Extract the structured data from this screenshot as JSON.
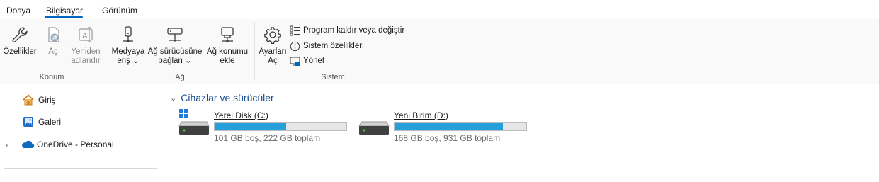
{
  "menu": {
    "tabs": [
      "Dosya",
      "Bilgisayar",
      "Görünüm"
    ],
    "active": "Bilgisayar"
  },
  "ribbon": {
    "konum": {
      "label": "Konum",
      "buttons": [
        {
          "label_1": "Özellikler",
          "label_2": "",
          "icon": "wrench-icon",
          "enabled": true
        },
        {
          "label_1": "Aç",
          "label_2": "",
          "icon": "open-icon",
          "enabled": false
        },
        {
          "label_1": "Yeniden",
          "label_2": "adlandır",
          "icon": "rename-icon",
          "enabled": false
        }
      ]
    },
    "ag": {
      "label": "Ağ",
      "buttons": [
        {
          "label_1": "Medyaya",
          "label_2": "eriş",
          "icon": "media-access-icon",
          "dropdown": true
        },
        {
          "label_1": "Ağ sürücüsüne",
          "label_2": "bağlan",
          "icon": "map-network-drive-icon",
          "dropdown": true
        },
        {
          "label_1": "Ağ konumu",
          "label_2": "ekle",
          "icon": "add-network-location-icon",
          "dropdown": false
        }
      ]
    },
    "sistem": {
      "label": "Sistem",
      "settings": {
        "label_1": "Ayarları",
        "label_2": "Aç",
        "icon": "gear-icon"
      },
      "items": [
        {
          "label": "Program kaldır veya değiştir",
          "icon": "program-list-icon"
        },
        {
          "label": "Sistem özellikleri",
          "icon": "info-icon"
        },
        {
          "label": "Yönet",
          "icon": "manage-icon"
        }
      ]
    }
  },
  "nav": {
    "items": [
      {
        "label": "Giriş",
        "icon": "home-icon"
      },
      {
        "label": "Galeri",
        "icon": "gallery-icon"
      },
      {
        "label": "OneDrive - Personal",
        "icon": "onedrive-cloud-icon",
        "expandable": true
      }
    ]
  },
  "content": {
    "section_title": "Cihazlar ve sürücüler",
    "drives": [
      {
        "name": "Yerel Disk (C:)",
        "info": "101 GB boş, 222 GB toplam",
        "used_fraction": 0.545,
        "windows_badge": true
      },
      {
        "name": "Yeni Birim (D:)",
        "info": "168 GB boş, 931 GB toplam",
        "used_fraction": 0.82,
        "windows_badge": false
      }
    ]
  },
  "colors": {
    "accent": "#0067c0",
    "drive_bar_fill": "#26a0da",
    "section_title": "#1d4f91",
    "onedrive": "#0f6cbd",
    "home": "#e8a33d"
  }
}
